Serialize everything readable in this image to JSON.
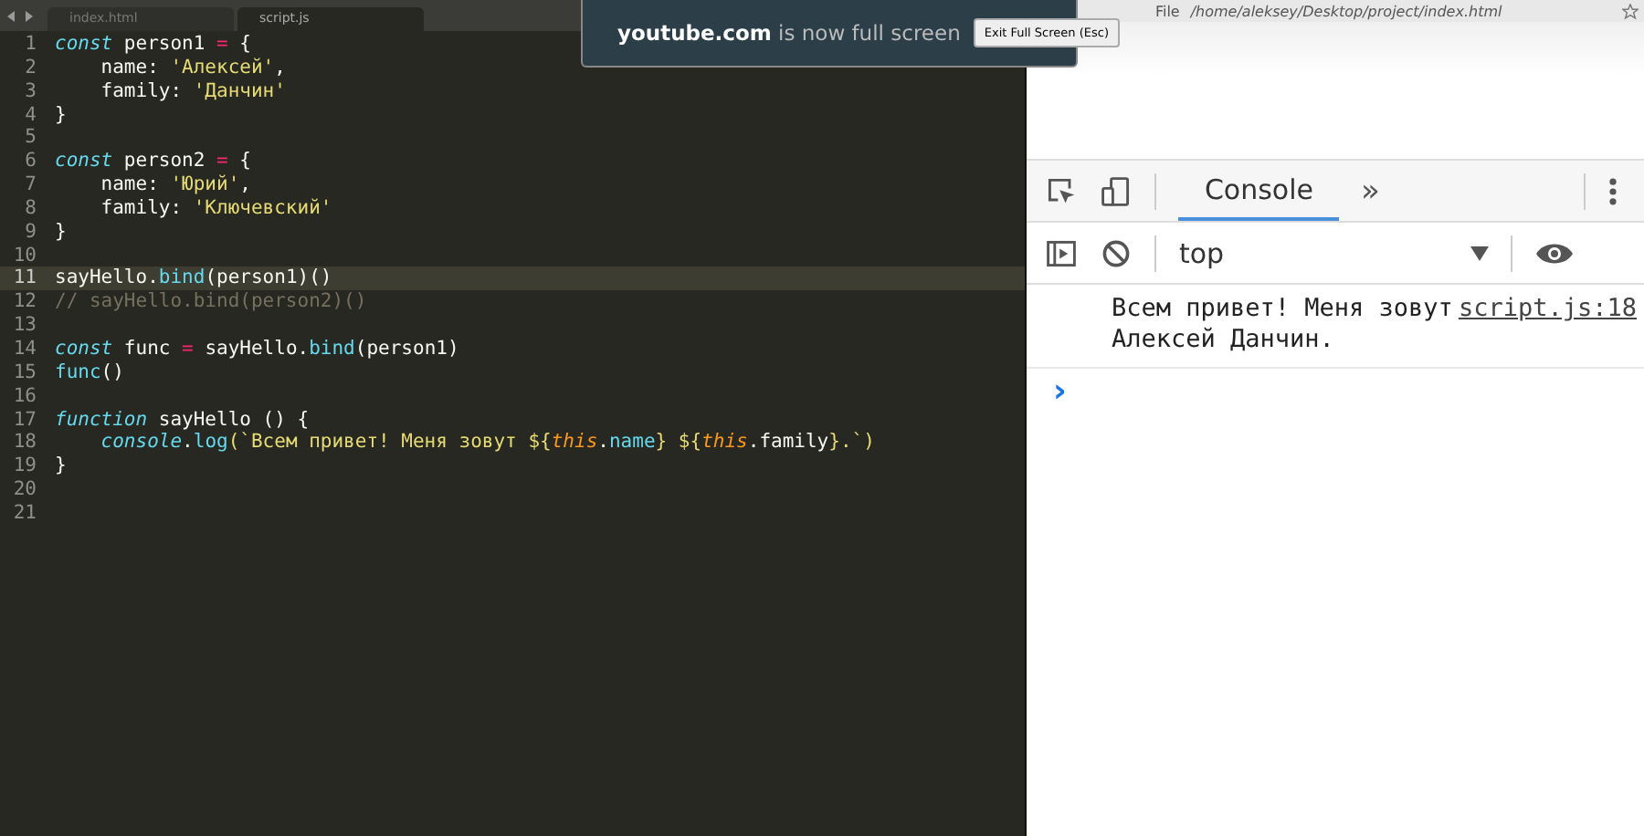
{
  "editor": {
    "tabs": [
      {
        "label": "index.html",
        "selected": false
      },
      {
        "label": "script.js",
        "selected": true
      }
    ],
    "lines": [
      {
        "number": "1",
        "highlighted": false,
        "tokens": [
          {
            "text": "const",
            "kind": "keyword"
          },
          {
            "text": " person1 ",
            "kind": "plain"
          },
          {
            "text": "=",
            "kind": "operator"
          },
          {
            "text": " {",
            "kind": "plain"
          }
        ]
      },
      {
        "number": "2",
        "highlighted": false,
        "tokens": [
          {
            "text": "    name: ",
            "kind": "plain"
          },
          {
            "text": "'Алексей'",
            "kind": "string"
          },
          {
            "text": ",",
            "kind": "plain"
          }
        ]
      },
      {
        "number": "3",
        "highlighted": false,
        "tokens": [
          {
            "text": "    family: ",
            "kind": "plain"
          },
          {
            "text": "'Данчин'",
            "kind": "string"
          }
        ]
      },
      {
        "number": "4",
        "highlighted": false,
        "tokens": [
          {
            "text": "}",
            "kind": "plain"
          }
        ]
      },
      {
        "number": "5",
        "highlighted": false
      },
      {
        "number": "6",
        "highlighted": false,
        "tokens": [
          {
            "text": "const",
            "kind": "keyword"
          },
          {
            "text": " person2 ",
            "kind": "plain"
          },
          {
            "text": "=",
            "kind": "operator"
          },
          {
            "text": " {",
            "kind": "plain"
          }
        ]
      },
      {
        "number": "7",
        "highlighted": false,
        "tokens": [
          {
            "text": "    name: ",
            "kind": "plain"
          },
          {
            "text": "'Юрий'",
            "kind": "string"
          },
          {
            "text": ",",
            "kind": "plain"
          }
        ]
      },
      {
        "number": "8",
        "highlighted": false,
        "tokens": [
          {
            "text": "    family: ",
            "kind": "plain"
          },
          {
            "text": "'Ключевский'",
            "kind": "string"
          }
        ]
      },
      {
        "number": "9",
        "highlighted": false,
        "tokens": [
          {
            "text": "}",
            "kind": "plain"
          }
        ]
      },
      {
        "number": "10",
        "highlighted": false
      },
      {
        "number": "11",
        "highlighted": true,
        "tokens": [
          {
            "text": "sayHello.",
            "kind": "plain"
          },
          {
            "text": "bind",
            "kind": "method"
          },
          {
            "text": "(person1)()",
            "kind": "plain"
          }
        ]
      },
      {
        "number": "12",
        "highlighted": false,
        "tokens": [
          {
            "text": "// sayHello.bind(person2)()",
            "kind": "comment"
          }
        ]
      },
      {
        "number": "13",
        "highlighted": false
      },
      {
        "number": "14",
        "highlighted": false,
        "tokens": [
          {
            "text": "const",
            "kind": "keyword"
          },
          {
            "text": " func ",
            "kind": "plain"
          },
          {
            "text": "=",
            "kind": "operator"
          },
          {
            "text": " sayHello.",
            "kind": "plain"
          },
          {
            "text": "bind",
            "kind": "method"
          },
          {
            "text": "(person1)",
            "kind": "plain"
          }
        ]
      },
      {
        "number": "15",
        "highlighted": false,
        "tokens": [
          {
            "text": "func",
            "kind": "method"
          },
          {
            "text": "()",
            "kind": "plain"
          }
        ]
      },
      {
        "number": "16",
        "highlighted": false
      },
      {
        "number": "17",
        "highlighted": false,
        "tokens": [
          {
            "text": "function",
            "kind": "keyword"
          },
          {
            "text": " sayHello () {",
            "kind": "plain"
          }
        ]
      },
      {
        "number": "18",
        "highlighted": false,
        "indented": true,
        "tokens": [
          {
            "text": "console",
            "kind": "keyword"
          },
          {
            "text": ".",
            "kind": "plain"
          },
          {
            "text": "log",
            "kind": "method"
          },
          {
            "text": "(`Всем привет! Меня зовут ${",
            "kind": "string"
          },
          {
            "text": "this",
            "kind": "this"
          },
          {
            "text": ".",
            "kind": "plain"
          },
          {
            "text": "name",
            "kind": "method"
          },
          {
            "text": "} ${",
            "kind": "string"
          },
          {
            "text": "this",
            "kind": "this"
          },
          {
            "text": ".family",
            "kind": "plain"
          },
          {
            "text": "}.`)",
            "kind": "string"
          }
        ]
      },
      {
        "number": "19",
        "highlighted": false,
        "tokens": [
          {
            "text": "}",
            "kind": "plain"
          }
        ]
      },
      {
        "number": "20",
        "highlighted": false
      },
      {
        "number": "21",
        "highlighted": false
      }
    ]
  },
  "browser": {
    "address_scheme": "File",
    "address": "/home/aleksey/Desktop/project/index.html"
  },
  "fullscreen_notice": {
    "domain": "youtube.com",
    "message": "is now full screen",
    "button": "Exit Full Screen (Esc)"
  },
  "devtools": {
    "tabs": [
      {
        "label": "Console",
        "selected": true
      }
    ],
    "more_tabs": "»",
    "context": "top",
    "messages": [
      {
        "text": "Всем привет! Меня зовут Алексей Данчин.",
        "source": "script.js:18"
      }
    ],
    "prompt": "›"
  }
}
